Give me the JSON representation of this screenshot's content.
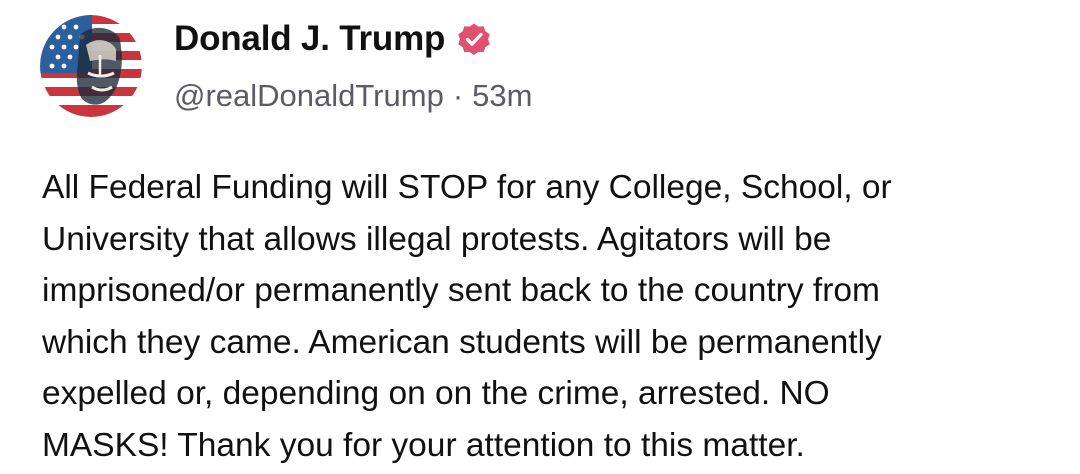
{
  "author": {
    "display_name": "Donald J. Trump",
    "handle": "@realDonaldTrump",
    "separator": "·",
    "time_ago": "53m",
    "verified": true,
    "avatar_icon": "flag-portrait-avatar"
  },
  "post": {
    "lines": [
      "All Federal Funding will STOP for any College, School, or",
      "University that allows illegal protests. Agitators will be",
      "imprisoned/or permanently sent back to the country from",
      "which they came. American students will be permanently",
      "expelled or, depending on on the crime, arrested. NO",
      "MASKS! Thank you for your attention to this matter."
    ]
  },
  "colors": {
    "verified_badge": "#e0506f",
    "meta_text": "#5b5b66",
    "body_text": "#111111"
  }
}
